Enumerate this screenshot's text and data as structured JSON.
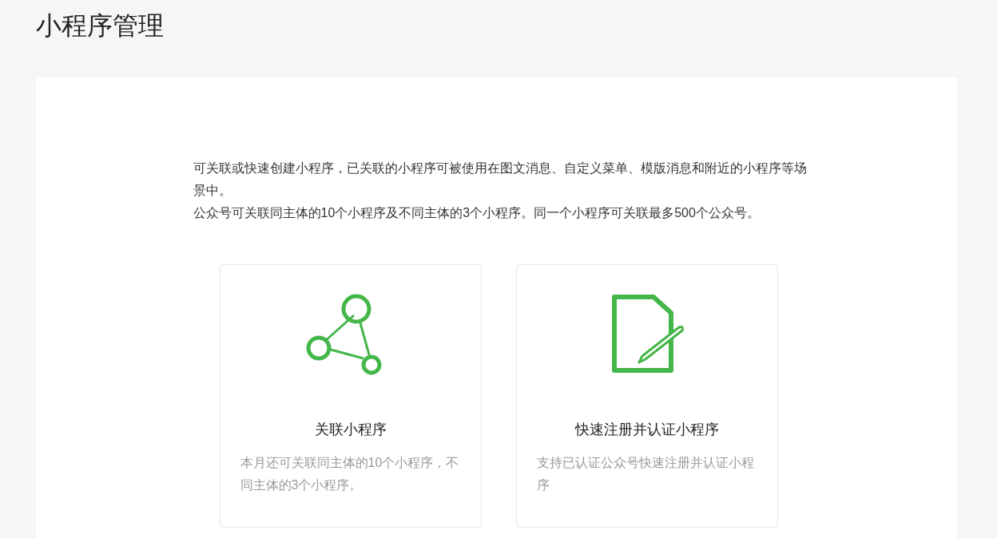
{
  "page_title": "小程序管理",
  "intro": [
    "可关联或快速创建小程序，已关联的小程序可被使用在图文消息、自定义菜单、模版消息和附近的小程序等场景中。",
    "公众号可关联同主体的10个小程序及不同主体的3个小程序。同一个小程序可关联最多500个公众号。"
  ],
  "cards": [
    {
      "kind": "link",
      "title": "关联小程序",
      "description": "本月还可关联同主体的10个小程序，不同主体的3个小程序。"
    },
    {
      "kind": "register",
      "title": "快速注册并认证小程序",
      "description": "支持已认证公众号快速注册并认证小程序"
    }
  ]
}
